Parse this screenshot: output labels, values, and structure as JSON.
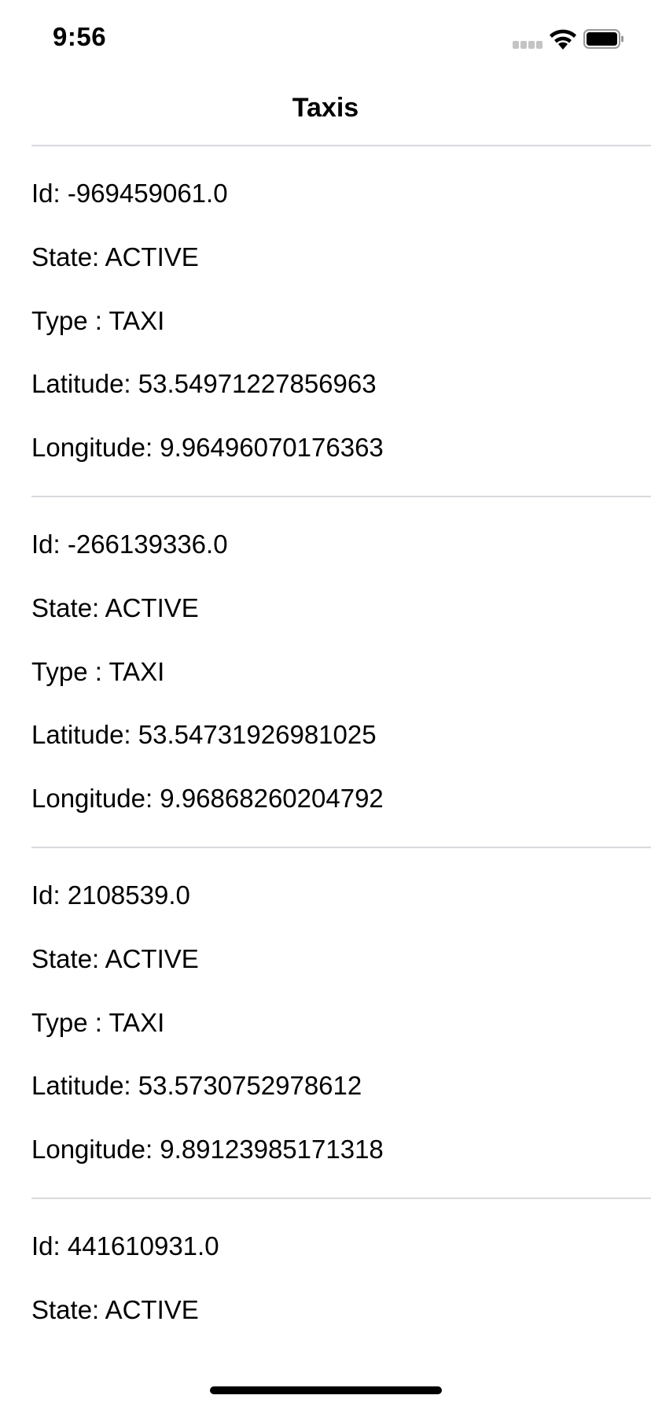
{
  "status_bar": {
    "time": "9:56",
    "icons": [
      "cellular-signal-icon",
      "wifi-icon",
      "battery-icon"
    ]
  },
  "navigation": {
    "title": "Taxis"
  },
  "taxis": [
    {
      "id": "Id: -969459061.0",
      "state": "State: ACTIVE",
      "type": "Type : TAXI",
      "latitude": "Latitude: 53.54971227856963",
      "longitude": "Longitude: 9.96496070176363"
    },
    {
      "id": "Id: -266139336.0",
      "state": "State: ACTIVE",
      "type": "Type : TAXI",
      "latitude": "Latitude: 53.54731926981025",
      "longitude": "Longitude: 9.96868260204792"
    },
    {
      "id": "Id: 2108539.0",
      "state": "State: ACTIVE",
      "type": "Type : TAXI",
      "latitude": "Latitude: 53.5730752978612",
      "longitude": "Longitude: 9.89123985171318"
    },
    {
      "id": "Id: 441610931.0",
      "state": "State: ACTIVE"
    }
  ]
}
